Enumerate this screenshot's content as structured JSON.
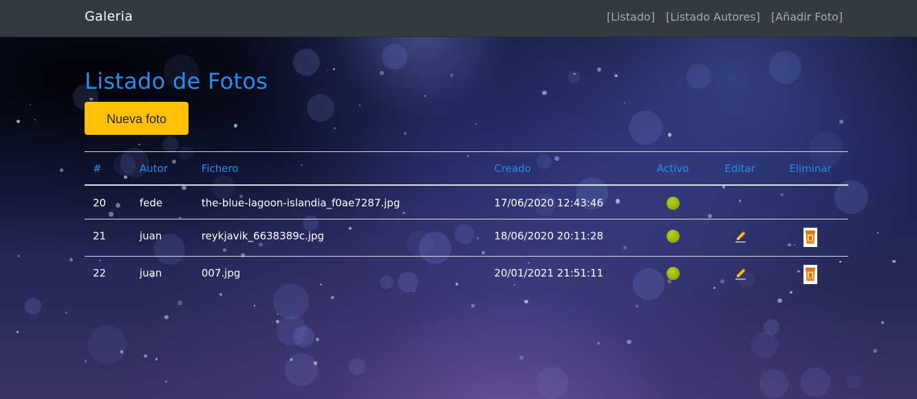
{
  "navbar": {
    "brand": "Galeria",
    "links": [
      "[Listado]",
      "[Listado Autores]",
      "[Añadir Foto]"
    ]
  },
  "page": {
    "title": "Listado de Fotos",
    "new_button": "Nueva foto"
  },
  "table": {
    "headers": [
      "#",
      "Autor",
      "Fichero",
      "Creado",
      "Activo",
      "Editar",
      "Eliminar"
    ],
    "rows": [
      {
        "id": "20",
        "autor": "fede",
        "fichero": "the-blue-lagoon-islandia_f0ae7287.jpg",
        "creado": "17/06/2020 12:43:46",
        "activo": true,
        "editable": false,
        "deletable": false
      },
      {
        "id": "21",
        "autor": "juan",
        "fichero": "reykjavik_6638389c.jpg",
        "creado": "18/06/2020 20:11:28",
        "activo": true,
        "editable": true,
        "deletable": true
      },
      {
        "id": "22",
        "autor": "juan",
        "fichero": "007.jpg",
        "creado": "20/01/2021 21:51:11",
        "activo": true,
        "editable": true,
        "deletable": true
      }
    ]
  },
  "colors": {
    "navbar_bg": "#343a40",
    "link": "#2a8cf0",
    "button": "#ffc107",
    "active_dot": "#98b10c"
  },
  "icons": {
    "active": "green-circle-icon",
    "edit": "pencil-icon",
    "delete": "trash-can-icon"
  }
}
